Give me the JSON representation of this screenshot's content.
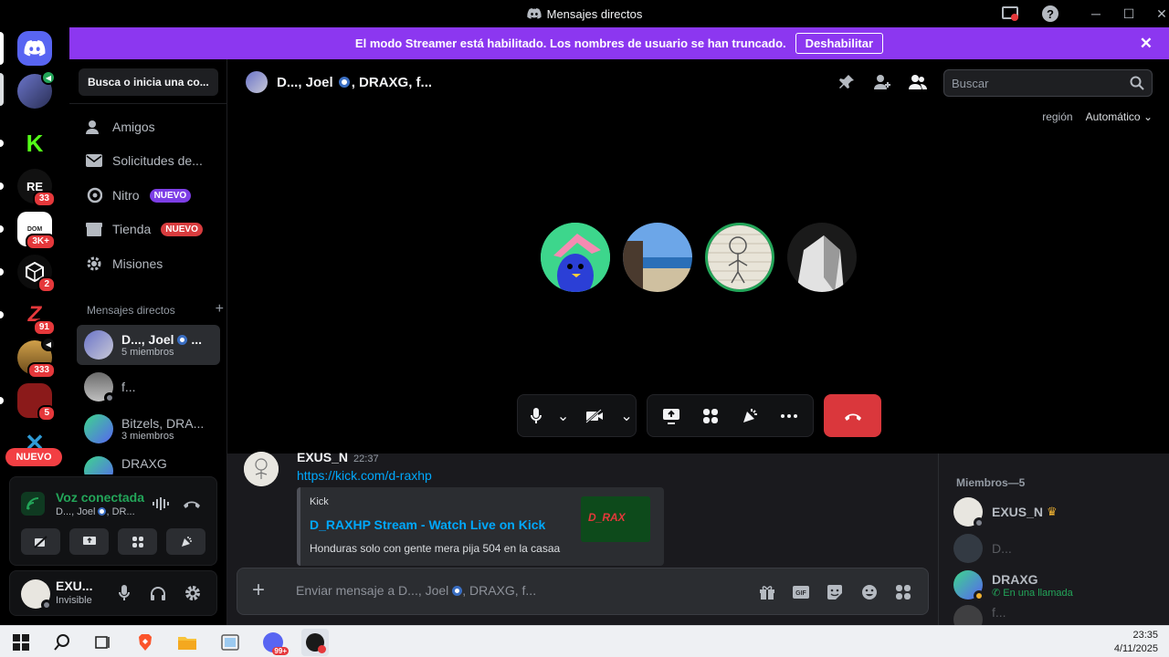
{
  "window": {
    "title": "Mensajes directos"
  },
  "banner": {
    "text": "El modo Streamer está habilitado. Los nombres de usuario se han truncado.",
    "button": "Deshabilitar"
  },
  "servers": [
    {
      "badge": ""
    },
    {
      "badge": ""
    },
    {
      "badge": ""
    },
    {
      "badge": "33"
    },
    {
      "badge": "3K+"
    },
    {
      "badge": "2"
    },
    {
      "badge": "91"
    },
    {
      "badge": "333"
    },
    {
      "badge": "5"
    },
    {
      "badge": ""
    }
  ],
  "rail_new_label": "NUEVO",
  "sidebar": {
    "search_placeholder": "Busca o inicia una co...",
    "nav": [
      {
        "label": "Amigos",
        "tag": ""
      },
      {
        "label": "Solicitudes de...",
        "tag": ""
      },
      {
        "label": "Nitro",
        "tag": "NUEVO"
      },
      {
        "label": "Tienda",
        "tag": "NUEVO"
      },
      {
        "label": "Misiones",
        "tag": ""
      }
    ],
    "dm_header": "Mensajes directos",
    "dms": [
      {
        "name": "D..., Joel",
        "suffix": "...",
        "sub": "5 miembros"
      },
      {
        "name": "f...",
        "sub": ""
      },
      {
        "name": "Bitzels, DRA...",
        "sub": "3 miembros"
      },
      {
        "name": "DRAXG",
        "sub": ""
      }
    ]
  },
  "voice": {
    "status": "Voz conectada",
    "channel": "D..., Joel",
    "channel_suffix": ", DR..."
  },
  "user": {
    "name": "EXU...",
    "status": "Invisible"
  },
  "call": {
    "title": "D..., Joel",
    "title_suffix": ", DRAXG, f...",
    "search_placeholder": "Buscar",
    "region_label": "región",
    "region_value": "Automático"
  },
  "chat": {
    "author": "EXUS_N",
    "time": "22:37",
    "link": "https://kick.com/d-raxhp",
    "embed": {
      "provider": "Kick",
      "title": "D_RAXHP Stream - Watch Live on Kick",
      "description": "Honduras solo con gente mera pija 504 en la casaa",
      "thumb_text": "D_RAX"
    },
    "composer_placeholder": "Enviar mensaje a D..., Joel",
    "composer_suffix": ", DRAXG, f..."
  },
  "members": {
    "header": "Miembros—5",
    "list": [
      {
        "name": "EXUS_N",
        "status": ""
      },
      {
        "name": "D...",
        "status": ""
      },
      {
        "name": "DRAXG",
        "status": "En una llamada"
      },
      {
        "name": "f...",
        "status": ""
      }
    ]
  },
  "taskbar": {
    "time": "23:35",
    "date": "4/11/2025",
    "edge_badge": "99+"
  },
  "colors": {
    "banner": "#8c37f0",
    "endcall": "#da373c",
    "connected": "#23a559",
    "link": "#00a8fc"
  }
}
